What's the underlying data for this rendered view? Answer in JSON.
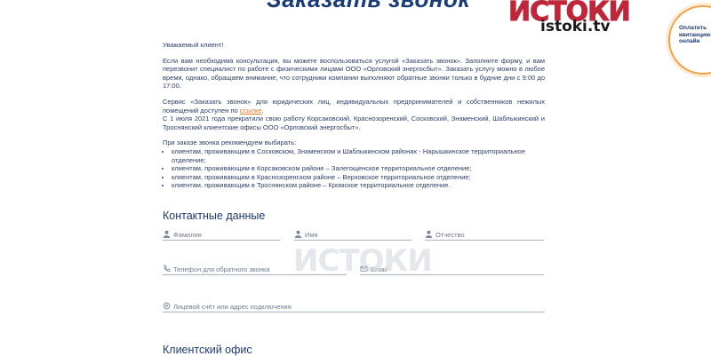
{
  "header": {
    "title": "Заказать звонок",
    "logo_text": "ИСТОКИ",
    "logo_site": "istoki.tv",
    "pay_badge": "Оплатить квитанцию онлайн"
  },
  "intro": {
    "greeting": "Уважаемый клиент!",
    "para1": "Если вам необходима консультация, вы можете воспользоваться услугой «Заказать звонок». Заполните форму, и вам перезвонит специалист по работе с физическими лицами ООО «Орловский энергосбыт». Заказать услугу можно в любое время, однако, обращаем внимание, что сотрудники компании выполняют обратные звонки только в будние дни с 9:00 до 17:00.",
    "para2_pre": "Сервис «Заказать звонок» для юридических лиц, индивидуальных предпринимателей и собственников нежилых помещений доступен по ",
    "para2_link": "ссылке",
    "para2_post": ".",
    "para3": "С 1 июля 2021 года прекратили свою работу Корсаковский, Краснозоренский, Сосковский, Знаменский, Шаблыкинский и Троснянский клиентские офисы ООО «Орловский энергосбыт».",
    "rec_title": "При заказе звонка рекомендуем выбирать:",
    "rec_items": [
      "клиентам, проживающим в Сосковском, Знаменском и Шаблыкинском районах - Нарышкинское территориальное отделение;",
      "клиентам, проживающим в Корсаковском районе – Залегощенское территориальное отделение;",
      "клиентам, проживающим в Краснозоренском районе – Верховское территориальное отделение;",
      "клиентам, проживающим в Троснянском районе – Кромское территориальное отделение."
    ]
  },
  "contact": {
    "title": "Контактные данные",
    "surname": "Фамилия",
    "name": "Имя",
    "patronymic": "Отчество",
    "phone": "Телефон для обратного звонка",
    "email": "Email",
    "account": "Лицевой счёт или адрес подключения"
  },
  "office": {
    "title": "Клиентский офис"
  },
  "watermark": "ИСТОКИ",
  "colors": {
    "title": "#1a3c78",
    "text": "#2c3e6a",
    "link": "#e07a2a",
    "logo": "#c0263a",
    "field_line": "#a8b4c8"
  }
}
